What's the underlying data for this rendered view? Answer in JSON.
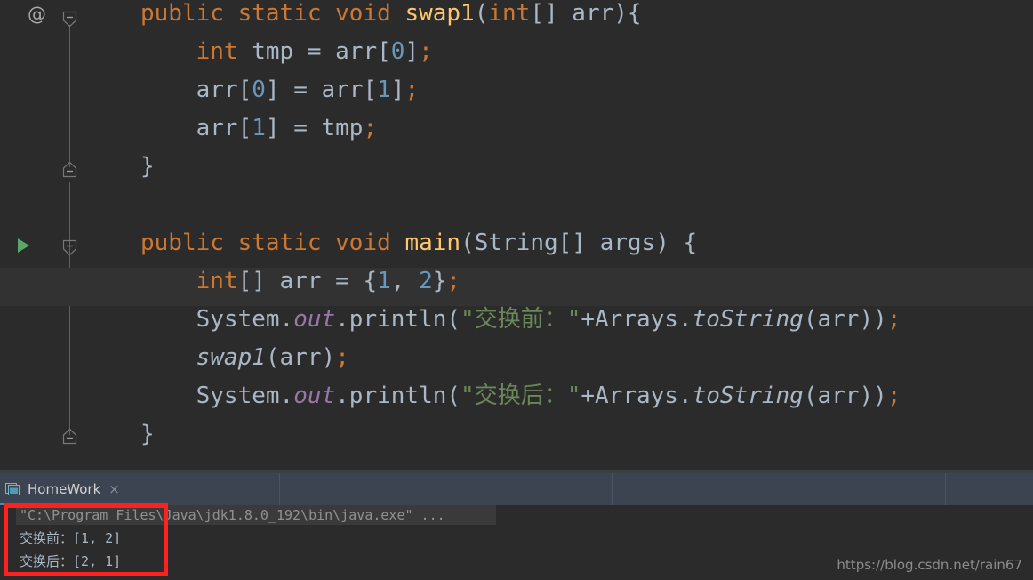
{
  "colors": {
    "editor_background": "#2b2b2b",
    "line_highlight": "#323232",
    "keyword": "#cc7832",
    "method_declaration": "#ffc66d",
    "string": "#6a8759",
    "number": "#6897bb",
    "default_text": "#a9b7c6",
    "static_field": "#9876aa",
    "run_arrow_green": "#59a869",
    "tab_active_underline": "#4a88c7",
    "annotation_red": "#ff2020"
  },
  "gutter": {
    "annotation_marker": "@",
    "run_arrow_icon": "run-arrow-icon",
    "fold_markers": [
      {
        "name": "fold-marker-collapse-swap1",
        "direction": "down"
      },
      {
        "name": "fold-marker-end-swap1",
        "direction": "up"
      },
      {
        "name": "fold-marker-collapse-main",
        "direction": "down"
      },
      {
        "name": "fold-marker-end-main",
        "direction": "up"
      }
    ]
  },
  "editor": {
    "lines": [
      {
        "id": "line-swap1-signature",
        "tokens": [
          {
            "t": "public ",
            "c": "kw"
          },
          {
            "t": "static ",
            "c": "kw"
          },
          {
            "t": "void ",
            "c": "kw"
          },
          {
            "t": "swap1",
            "c": "method"
          },
          {
            "t": "(",
            "c": "punct"
          },
          {
            "t": "int",
            "c": "kw"
          },
          {
            "t": "[] arr)",
            "c": "plain"
          },
          {
            "t": "{",
            "c": "punct"
          }
        ]
      },
      {
        "id": "line-tmp-assign",
        "tokens": [
          {
            "t": "    ",
            "c": "plain"
          },
          {
            "t": "int ",
            "c": "kw"
          },
          {
            "t": "tmp = arr[",
            "c": "plain"
          },
          {
            "t": "0",
            "c": "num"
          },
          {
            "t": "]",
            "c": "plain"
          },
          {
            "t": ";",
            "c": "semi"
          }
        ]
      },
      {
        "id": "line-arr0-assign",
        "tokens": [
          {
            "t": "    arr[",
            "c": "plain"
          },
          {
            "t": "0",
            "c": "num"
          },
          {
            "t": "] = arr[",
            "c": "plain"
          },
          {
            "t": "1",
            "c": "num"
          },
          {
            "t": "]",
            "c": "plain"
          },
          {
            "t": ";",
            "c": "semi"
          }
        ]
      },
      {
        "id": "line-arr1-assign",
        "tokens": [
          {
            "t": "    arr[",
            "c": "plain"
          },
          {
            "t": "1",
            "c": "num"
          },
          {
            "t": "] = tmp",
            "c": "plain"
          },
          {
            "t": ";",
            "c": "semi"
          }
        ]
      },
      {
        "id": "line-swap1-close",
        "tokens": [
          {
            "t": "}",
            "c": "punct"
          }
        ]
      },
      {
        "id": "line-blank-1",
        "tokens": []
      },
      {
        "id": "line-main-signature",
        "tokens": [
          {
            "t": "public ",
            "c": "kw"
          },
          {
            "t": "static ",
            "c": "kw"
          },
          {
            "t": "void ",
            "c": "kw"
          },
          {
            "t": "main",
            "c": "method"
          },
          {
            "t": "(String[] args) {",
            "c": "plain"
          }
        ]
      },
      {
        "id": "line-arr-init",
        "tokens": [
          {
            "t": "    ",
            "c": "plain"
          },
          {
            "t": "int",
            "c": "kw"
          },
          {
            "t": "[] arr = {",
            "c": "plain"
          },
          {
            "t": "1",
            "c": "num"
          },
          {
            "t": ", ",
            "c": "plain"
          },
          {
            "t": "2",
            "c": "num"
          },
          {
            "t": "}",
            "c": "plain"
          },
          {
            "t": ";",
            "c": "semi"
          }
        ]
      },
      {
        "id": "line-println-before",
        "tokens": [
          {
            "t": "    System.",
            "c": "plain"
          },
          {
            "t": "out",
            "c": "field-static"
          },
          {
            "t": ".println(",
            "c": "plain"
          },
          {
            "t": "\"交换前：\"",
            "c": "str"
          },
          {
            "t": "+Arrays.",
            "c": "plain"
          },
          {
            "t": "toString",
            "c": "static-m"
          },
          {
            "t": "(arr))",
            "c": "plain"
          },
          {
            "t": ";",
            "c": "semi"
          }
        ]
      },
      {
        "id": "line-swap1-call",
        "tokens": [
          {
            "t": "    ",
            "c": "plain"
          },
          {
            "t": "swap1",
            "c": "methodcall"
          },
          {
            "t": "(arr)",
            "c": "plain"
          },
          {
            "t": ";",
            "c": "semi"
          }
        ]
      },
      {
        "id": "line-println-after",
        "tokens": [
          {
            "t": "    System.",
            "c": "plain"
          },
          {
            "t": "out",
            "c": "field-static"
          },
          {
            "t": ".println(",
            "c": "plain"
          },
          {
            "t": "\"交换后：\"",
            "c": "str"
          },
          {
            "t": "+Arrays.",
            "c": "plain"
          },
          {
            "t": "toString",
            "c": "static-m"
          },
          {
            "t": "(arr))",
            "c": "plain"
          },
          {
            "t": ";",
            "c": "semi"
          }
        ]
      },
      {
        "id": "line-main-close",
        "tokens": [
          {
            "t": "}",
            "c": "punct"
          }
        ]
      }
    ],
    "highlighted_line_index": 7
  },
  "tool_window": {
    "active_tab": {
      "icon": "console-window-icon",
      "label": "HomeWork",
      "close_label": "×"
    }
  },
  "console": {
    "command_line": "\"C:\\Program Files\\Java\\jdk1.8.0_192\\bin\\java.exe\" ...",
    "output_lines": [
      "交换前：[1, 2]",
      "交换后：[2, 1]"
    ]
  },
  "watermark": {
    "text": "https://blog.csdn.net/rain67"
  }
}
